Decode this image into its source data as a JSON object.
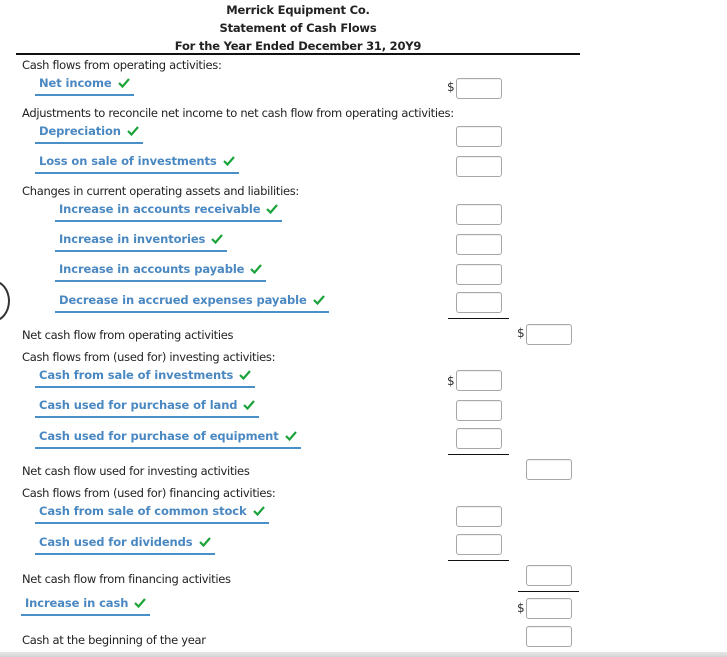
{
  "header": {
    "company": "Merrick Equipment Co.",
    "statement": "Statement of Cash Flows",
    "period": "For the Year Ended December 31, 20Y9"
  },
  "currency_symbol": "$",
  "check_color": "#1aa33a",
  "select_color": "#4a88c2",
  "operating": {
    "heading": "Cash flows from operating activities:",
    "net_income": "Net income",
    "adjustments_heading": "Adjustments to reconcile net income to net cash flow from operating activities:",
    "adjustments": [
      "Depreciation",
      "Loss on sale of investments"
    ],
    "changes_heading": "Changes in current operating assets and liabilities:",
    "changes": [
      "Increase in accounts receivable",
      "Increase in inventories",
      "Increase in accounts payable",
      "Decrease in accrued expenses payable"
    ],
    "total_label": "Net cash flow from operating activities"
  },
  "investing": {
    "heading": "Cash flows from (used for) investing activities:",
    "items": [
      "Cash from sale of investments",
      "Cash used for purchase of land",
      "Cash used for purchase of equipment"
    ],
    "total_label": "Net cash flow used for investing activities"
  },
  "financing": {
    "heading": "Cash flows from (used for) financing activities:",
    "items": [
      "Cash from sale of common stock",
      "Cash used for dividends"
    ],
    "total_label": "Net cash flow from financing activities"
  },
  "summary": {
    "increase_in_cash": "Increase in cash",
    "beginning_cash": "Cash at the beginning of the year"
  },
  "inputs": {
    "net_income": "",
    "depreciation": "",
    "loss_on_sale": "",
    "ar": "",
    "inventories": "",
    "ap": "",
    "accrued": "",
    "net_operating": "",
    "sale_investments": "",
    "purchase_land": "",
    "purchase_equipment": "",
    "net_investing": "",
    "sale_stock": "",
    "dividends": "",
    "net_financing": "",
    "increase_cash": "",
    "beginning_cash": ""
  }
}
